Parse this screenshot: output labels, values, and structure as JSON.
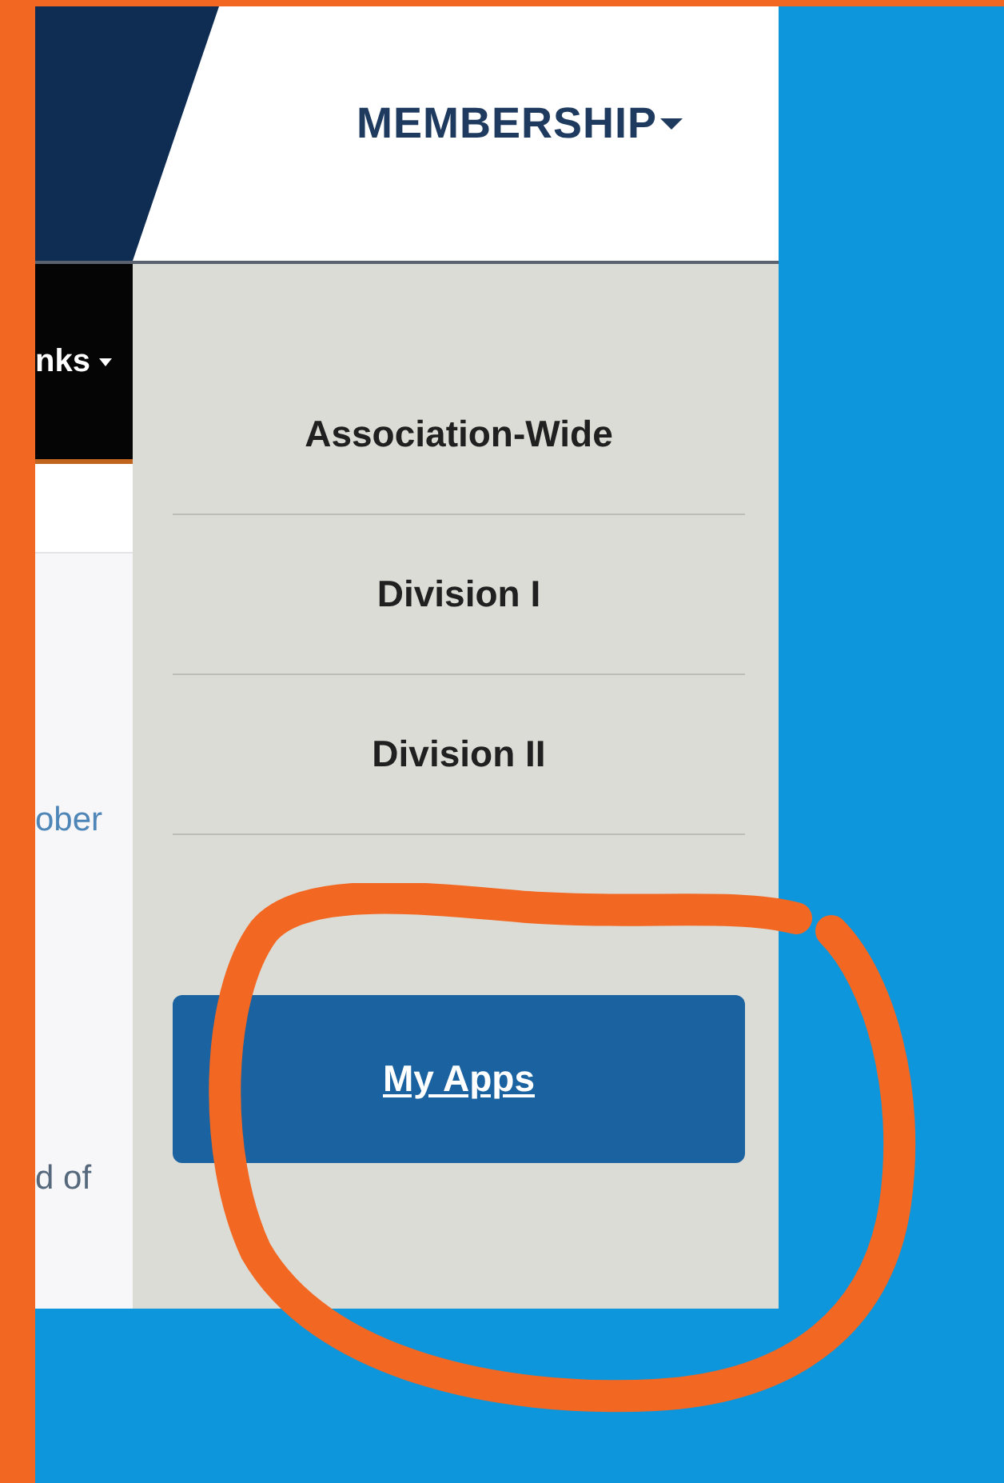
{
  "header": {
    "nav_item": {
      "label": "MEMBERSHIP",
      "expanded": true
    }
  },
  "left_column": {
    "nav_label": "nks",
    "texts": [
      {
        "text": "ober",
        "kind": "link"
      },
      {
        "text": "d of",
        "kind": "plain"
      }
    ]
  },
  "dropdown": {
    "items": [
      {
        "label": "Association-Wide",
        "kind": "link"
      },
      {
        "label": "Division I",
        "kind": "link"
      },
      {
        "label": "Division II",
        "kind": "link"
      },
      {
        "kind": "covered"
      },
      {
        "label": "My Apps",
        "kind": "button"
      }
    ]
  },
  "annotation": {
    "kind": "circle"
  }
}
